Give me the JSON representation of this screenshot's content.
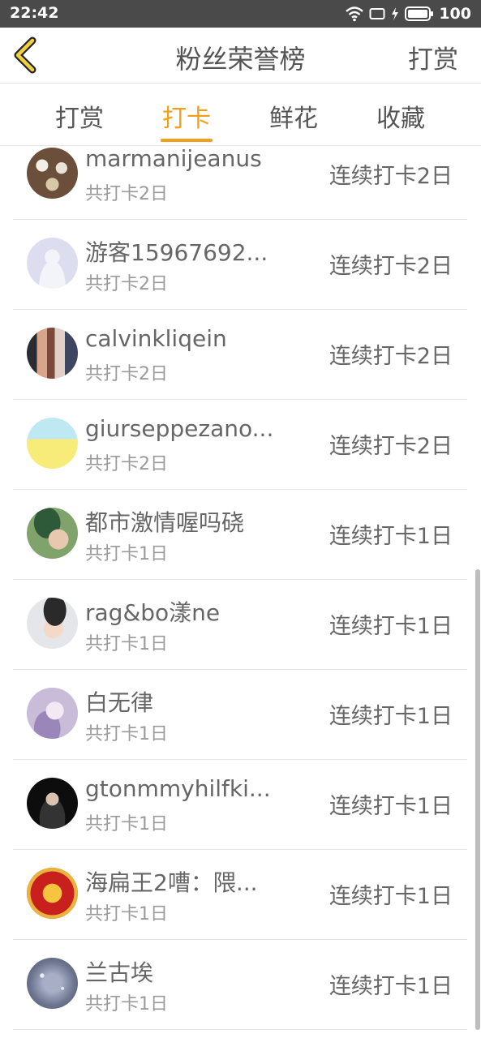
{
  "status_bar": {
    "time": "22:42",
    "battery": "100",
    "icons": [
      "wifi-icon",
      "screen-rotate-icon",
      "charging-icon",
      "battery-icon"
    ]
  },
  "header": {
    "back_icon": "chevron-left-icon",
    "title": "粉丝荣誉榜",
    "action": "打赏"
  },
  "tabs": [
    {
      "label": "打赏",
      "active": false
    },
    {
      "label": "打卡",
      "active": true
    },
    {
      "label": "鲜花",
      "active": false
    },
    {
      "label": "收藏",
      "active": false
    }
  ],
  "accent_color": "#f0a01a",
  "fans": [
    {
      "name": "marmanijeanus",
      "total": "共打卡2日",
      "streak": "连续打卡2日",
      "avatar": "food-photo"
    },
    {
      "name": "游客15967692...",
      "total": "共打卡2日",
      "streak": "连续打卡2日",
      "avatar": "default-user"
    },
    {
      "name": "calvinkliqein",
      "total": "共打卡2日",
      "streak": "连续打卡2日",
      "avatar": "people-photo"
    },
    {
      "name": "giurseppezano...",
      "total": "共打卡2日",
      "streak": "连续打卡2日",
      "avatar": "flower-field"
    },
    {
      "name": "都市激情喔吗硗",
      "total": "共打卡1日",
      "streak": "连续打卡1日",
      "avatar": "boy-in-green"
    },
    {
      "name": "rag&bo漾ne",
      "total": "共打卡1日",
      "streak": "连续打卡1日",
      "avatar": "portrait"
    },
    {
      "name": "白无律",
      "total": "共打卡1日",
      "streak": "连续打卡1日",
      "avatar": "anime-character"
    },
    {
      "name": "gtonmmyhilfki...",
      "total": "共打卡1日",
      "streak": "连续打卡1日",
      "avatar": "dark-portrait"
    },
    {
      "name": "海扁王2嘈：隈...",
      "total": "共打卡1日",
      "streak": "连续打卡1日",
      "avatar": "fu-charm"
    },
    {
      "name": "兰古埃",
      "total": "共打卡1日",
      "streak": "连续打卡1日",
      "avatar": "galaxy"
    }
  ]
}
